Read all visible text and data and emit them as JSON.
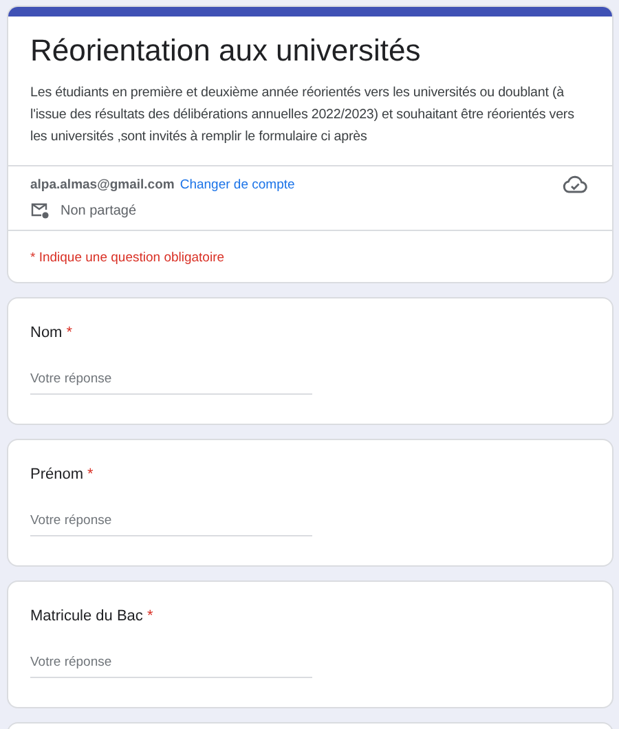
{
  "form": {
    "title": "Réorientation aux universités",
    "description": "Les étudiants en première et deuxième année réorientés vers les universités ou doublant (à l'issue des résultats des délibérations annuelles 2022/2023) et souhaitant être réorientés vers les universités ,sont invités à remplir le formulaire ci après",
    "account": {
      "email": "alpa.almas@gmail.com",
      "switch_link": "Changer de compte",
      "sharing": "Non partagé"
    },
    "required_note": "* Indique une question obligatoire"
  },
  "questions": [
    {
      "label": "Nom",
      "required": true,
      "required_mark": "*",
      "placeholder": "Votre réponse"
    },
    {
      "label": "Prénom",
      "required": true,
      "required_mark": "*",
      "placeholder": "Votre réponse"
    },
    {
      "label": "Matricule du Bac",
      "required": true,
      "required_mark": "*",
      "placeholder": "Votre réponse"
    }
  ]
}
